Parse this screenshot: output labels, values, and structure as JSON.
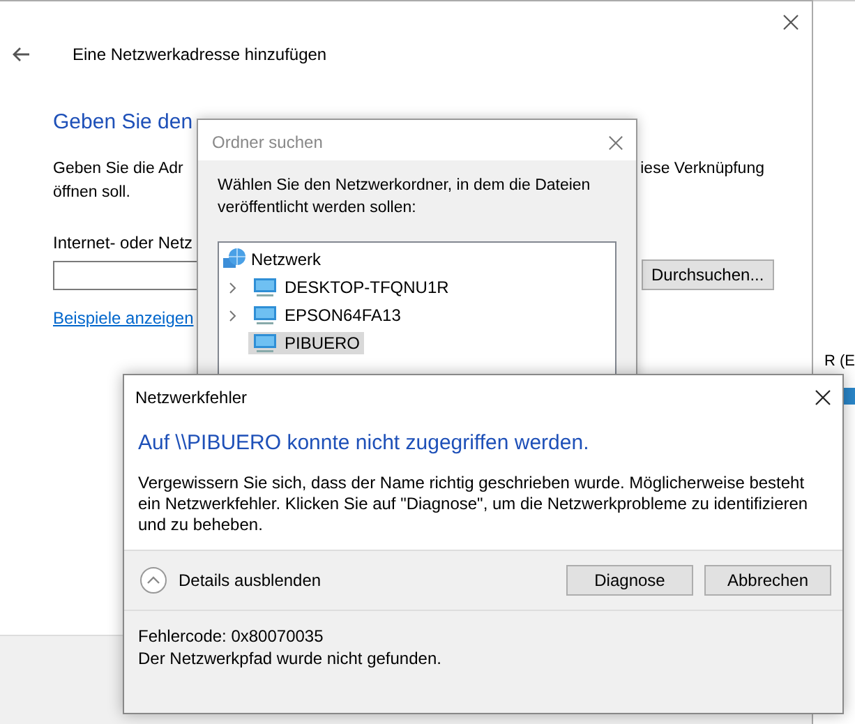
{
  "background_window": {
    "text": "R (E"
  },
  "wizard": {
    "title": "Eine Netzwerkadresse hinzufügen",
    "heading": "Geben Sie den",
    "instruction_left": [
      "Geben Sie die Adr",
      "öffnen soll."
    ],
    "instruction_right": "iese Verknüpfung",
    "address_label": "Internet- oder Netz",
    "browse_button": "Durchsuchen...",
    "examples_link": "Beispiele anzeigen"
  },
  "folder_dialog": {
    "title": "Ordner suchen",
    "prompt": "Wählen Sie den Netzwerkordner, in dem die Dateien veröffentlicht werden sollen:",
    "tree": [
      {
        "label": "Netzwerk",
        "kind": "network",
        "children": [
          {
            "label": "DESKTOP-TFQNU1R",
            "kind": "computer",
            "expandable": true,
            "selected": false
          },
          {
            "label": "EPSON64FA13",
            "kind": "computer",
            "expandable": true,
            "selected": false
          },
          {
            "label": "PIBUERO",
            "kind": "computer",
            "expandable": false,
            "selected": true
          }
        ]
      }
    ]
  },
  "error_dialog": {
    "title": "Netzwerkfehler",
    "heading": "Auf \\\\PIBUERO konnte nicht zugegriffen werden.",
    "message": "Vergewissern Sie sich, dass der Name richtig geschrieben wurde. Möglicherweise besteht ein Netzwerkfehler. Klicken Sie auf \"Diagnose\", um die Netzwerkprobleme zu identifizieren und zu beheben.",
    "details_toggle": {
      "label": "Details ausblenden",
      "expanded": true
    },
    "buttons": [
      "Diagnose",
      "Abbrechen"
    ],
    "details": [
      "Fehlercode: 0x80070035",
      "Der Netzwerkpfad wurde nicht gefunden."
    ]
  }
}
